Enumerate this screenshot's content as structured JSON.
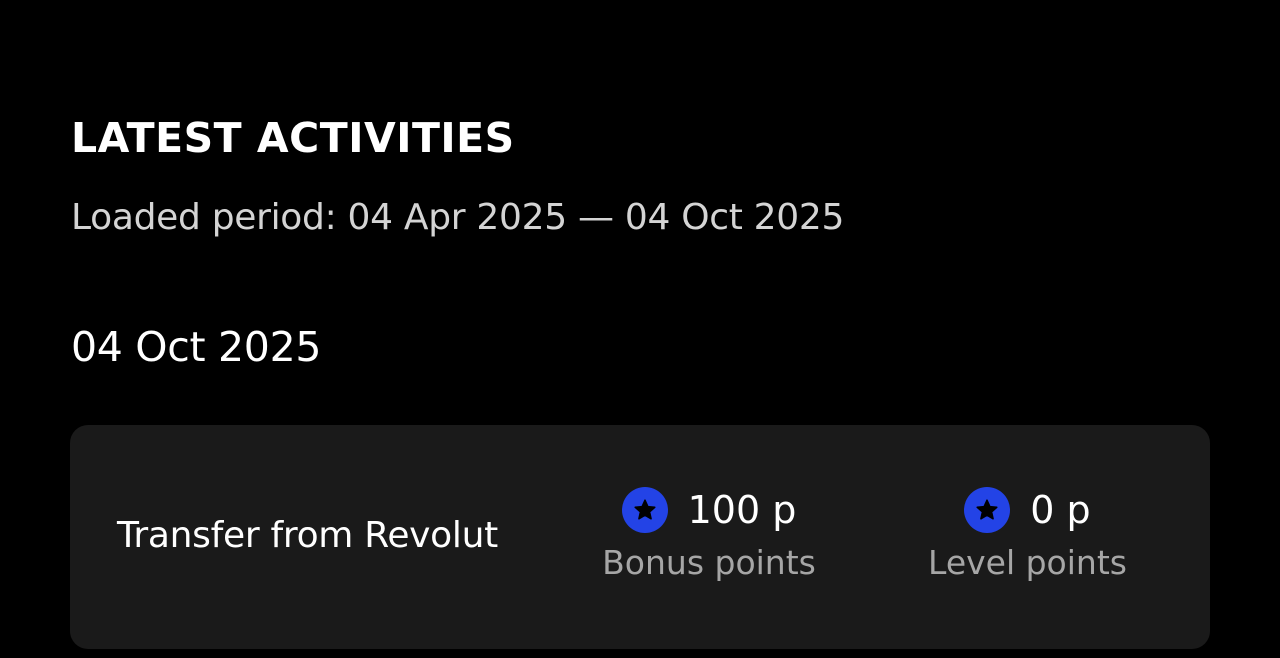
{
  "section": {
    "title": "LATEST ACTIVITIES",
    "loaded_period": "Loaded period: 04 Apr 2025 — 04 Oct 2025"
  },
  "groups": [
    {
      "date": "04 Oct 2025",
      "activities": [
        {
          "title": "Transfer from Revolut",
          "bonus_points": "100 p",
          "bonus_label": "Bonus points",
          "level_points": "0 p",
          "level_label": "Level points",
          "icon": "star-icon"
        }
      ]
    }
  ],
  "colors": {
    "background": "#000000",
    "card": "#1a1a1a",
    "accent": "#2343e6",
    "muted_text": "#a6a6a6"
  }
}
